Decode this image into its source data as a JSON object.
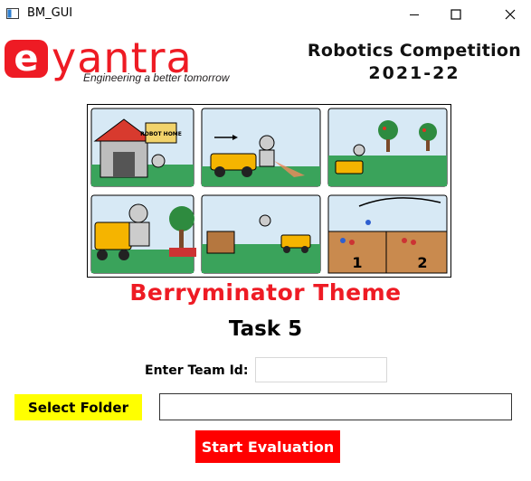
{
  "window": {
    "title": "BM_GUI",
    "controls": {
      "minimize_icon": "minimize-icon",
      "maximize_icon": "maximize-icon",
      "close_icon": "close-icon"
    }
  },
  "header": {
    "logo_text": "eyantra",
    "tagline": "Engineering a better tomorrow",
    "competition_line1": "Robotics Competition",
    "competition_line2": "2021-22"
  },
  "comic": {
    "panels": [
      {
        "sign_text": "ROBOT HOME"
      },
      {},
      {},
      {},
      {},
      {
        "labels": [
          "1",
          "2"
        ]
      }
    ]
  },
  "theme_title": "Berryminator Theme",
  "task_title": "Task 5",
  "form": {
    "team_id_label": "Enter Team Id:",
    "team_id_value": "",
    "select_folder_label": "Select Folder",
    "folder_path_value": "",
    "start_label": "Start Evaluation"
  },
  "colors": {
    "brand_red": "#ee1b24",
    "select_button_bg": "#ffff00",
    "start_button_bg": "#ff0000",
    "start_button_text": "#ffffff"
  }
}
